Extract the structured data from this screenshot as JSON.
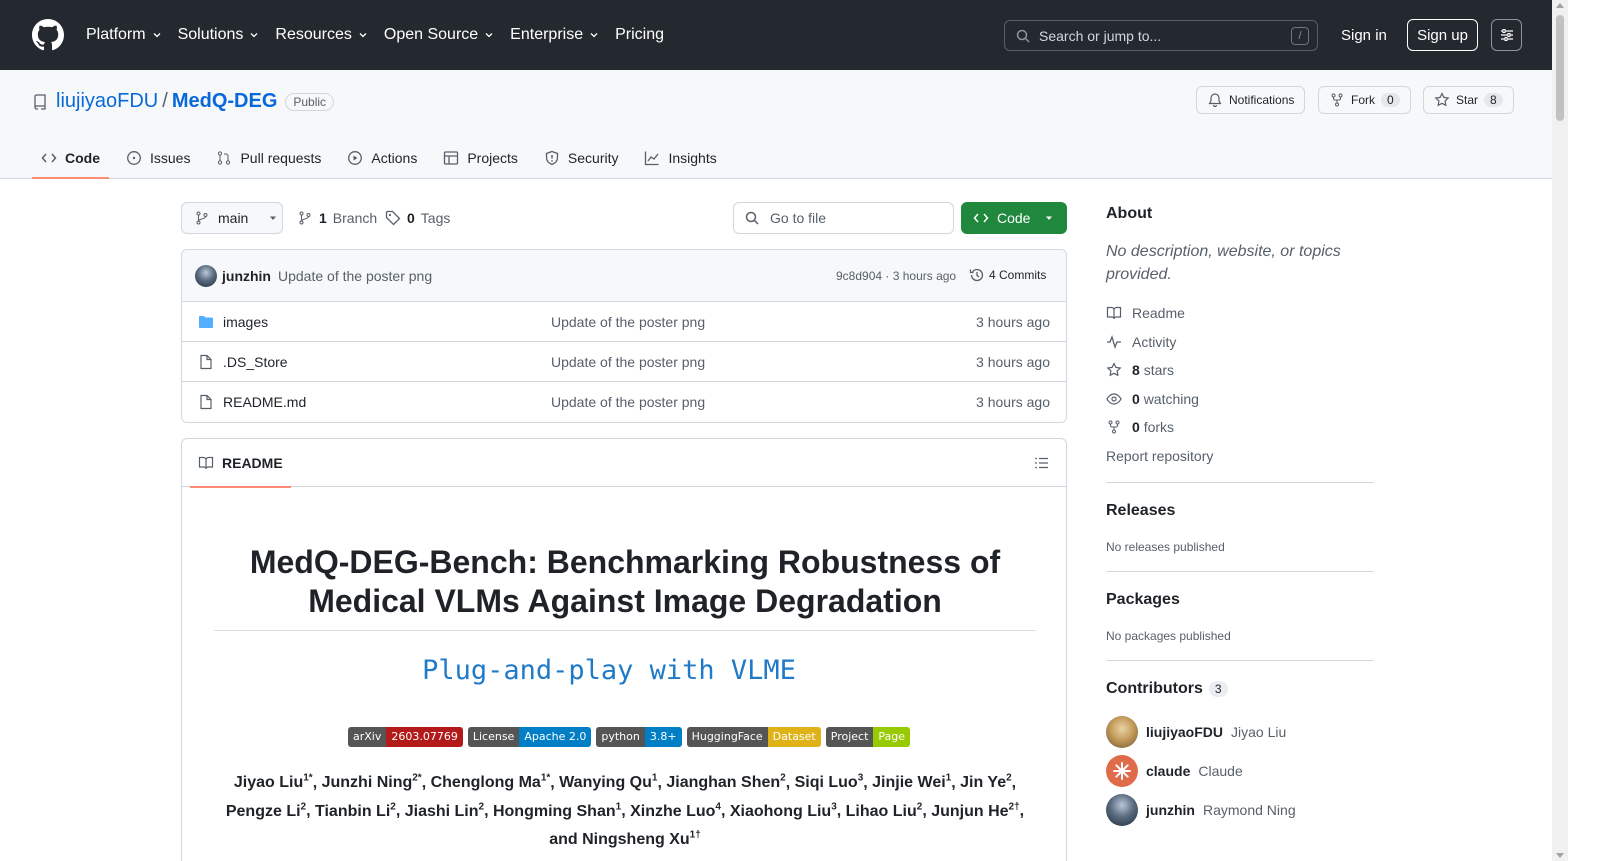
{
  "header": {
    "nav": [
      "Platform",
      "Solutions",
      "Resources",
      "Open Source",
      "Enterprise",
      "Pricing"
    ],
    "search_placeholder": "Search or jump to...",
    "search_shortcut": "/",
    "signin": "Sign in",
    "signup": "Sign up"
  },
  "repo": {
    "owner": "liujiyaoFDU",
    "separator": "/",
    "name": "MedQ-DEG",
    "visibility": "Public",
    "notifications": "Notifications",
    "fork_label": "Fork",
    "fork_count": "0",
    "star_label": "Star",
    "star_count": "8"
  },
  "tabs": [
    "Code",
    "Issues",
    "Pull requests",
    "Actions",
    "Projects",
    "Security",
    "Insights"
  ],
  "toolbar": {
    "branch": "main",
    "branch_count": "1",
    "branch_label": "Branch",
    "tag_count": "0",
    "tag_label": "Tags",
    "goto_file": "Go to file",
    "code_button": "Code"
  },
  "latest_commit": {
    "author": "junzhin",
    "message": "Update of the poster png",
    "sha_time": "9c8d904 · 3 hours ago",
    "commits": "4 Commits"
  },
  "files": [
    {
      "type": "folder",
      "name": "images",
      "message": "Update of the poster png",
      "time": "3 hours ago"
    },
    {
      "type": "file",
      "name": ".DS_Store",
      "message": "Update of the poster png",
      "time": "3 hours ago"
    },
    {
      "type": "file",
      "name": "README.md",
      "message": "Update of the poster png",
      "time": "3 hours ago"
    }
  ],
  "readme": {
    "tab_label": "README",
    "title": "MedQ-DEG-Bench: Benchmarking Robustness of Medical VLMs Against Image Degradation",
    "subtitle": "Plug-and-play with VLME",
    "badges": [
      {
        "left": "arXiv",
        "right": "2603.07769",
        "color": "#b31b1b"
      },
      {
        "left": "License",
        "right": "Apache 2.0",
        "color": "#007ec6"
      },
      {
        "left": "python",
        "right": "3.8+",
        "color": "#007ec6"
      },
      {
        "left": "HuggingFace",
        "right": "Dataset",
        "color": "#dfb317"
      },
      {
        "left": "Project",
        "right": "Page",
        "color": "#97ca00"
      }
    ],
    "authors": [
      {
        "name": "Jiyao Liu",
        "sup": "1*"
      },
      {
        "name": "Junzhi Ning",
        "sup": "2*"
      },
      {
        "name": "Chenglong Ma",
        "sup": "1*"
      },
      {
        "name": "Wanying Qu",
        "sup": "1"
      },
      {
        "name": "Jianghan Shen",
        "sup": "2"
      },
      {
        "name": "Siqi Luo",
        "sup": "3"
      },
      {
        "name": "Jinjie Wei",
        "sup": "1"
      },
      {
        "name": "Jin Ye",
        "sup": "2"
      },
      {
        "name": "Pengze Li",
        "sup": "2"
      },
      {
        "name": "Tianbin Li",
        "sup": "2"
      },
      {
        "name": "Jiashi Lin",
        "sup": "2"
      },
      {
        "name": "Hongming Shan",
        "sup": "1"
      },
      {
        "name": "Xinzhe Luo",
        "sup": "4"
      },
      {
        "name": "Xiaohong Liu",
        "sup": "3"
      },
      {
        "name": "Lihao Liu",
        "sup": "2"
      },
      {
        "name": "Junjun He",
        "sup": "2†"
      },
      {
        "name": "and Ningsheng Xu",
        "sup": "1†"
      }
    ]
  },
  "sidebar": {
    "about_title": "About",
    "about_desc": "No description, website, or topics provided.",
    "links": [
      {
        "icon": "book-icon",
        "bold": "",
        "text": "Readme"
      },
      {
        "icon": "pulse-icon",
        "bold": "",
        "text": "Activity"
      },
      {
        "icon": "star-icon",
        "bold": "8",
        "text": "stars"
      },
      {
        "icon": "eye-icon",
        "bold": "0",
        "text": "watching"
      },
      {
        "icon": "fork-icon",
        "bold": "0",
        "text": "forks"
      }
    ],
    "report": "Report repository",
    "releases_title": "Releases",
    "releases_text": "No releases published",
    "packages_title": "Packages",
    "packages_text": "No packages published",
    "contributors_title": "Contributors",
    "contributors_count": "3",
    "contributors": [
      {
        "login": "liujiyaoFDU",
        "name": "Jiyao Liu"
      },
      {
        "login": "claude",
        "name": "Claude"
      },
      {
        "login": "junzhin",
        "name": "Raymond Ning"
      }
    ]
  }
}
